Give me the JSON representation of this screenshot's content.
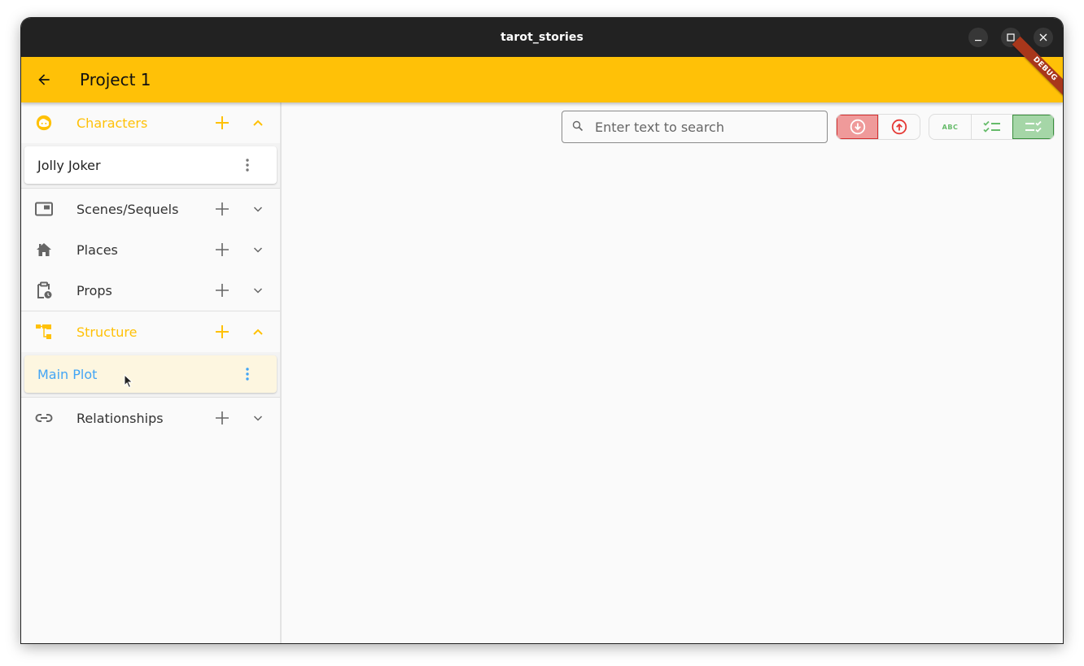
{
  "window": {
    "title": "tarot_stories",
    "controls": [
      "minimize-icon",
      "maximize-icon",
      "close-icon"
    ]
  },
  "appbar": {
    "back_icon": "arrow-back-icon",
    "title": "Project 1",
    "debug_banner": "DEBUG",
    "color": "#ffc107"
  },
  "sidebar": {
    "accent_color": "#ffc107",
    "sections": [
      {
        "label": "Characters",
        "icon": "face-icon",
        "expanded": true,
        "items": [
          {
            "label": "Jolly Joker",
            "selected": false
          }
        ]
      },
      {
        "label": "Scenes/Sequels",
        "icon": "picture-in-picture-icon",
        "expanded": false,
        "items": []
      },
      {
        "label": "Places",
        "icon": "home-icon",
        "expanded": false,
        "items": []
      },
      {
        "label": "Props",
        "icon": "clipboard-clock-icon",
        "expanded": false,
        "items": []
      },
      {
        "label": "Structure",
        "icon": "account-tree-icon",
        "expanded": true,
        "items": [
          {
            "label": "Main Plot",
            "selected": true
          }
        ]
      },
      {
        "label": "Relationships",
        "icon": "link-icon",
        "expanded": false,
        "items": []
      }
    ]
  },
  "toolbar": {
    "search": {
      "placeholder": "Enter text to search",
      "value": "",
      "icon": "search-icon"
    },
    "sort_group": {
      "buttons": [
        {
          "icon": "arrow-circle-down-icon",
          "active": true
        },
        {
          "icon": "arrow-circle-up-icon",
          "active": false
        }
      ],
      "active_color": "#ef9a9a"
    },
    "view_group": {
      "buttons": [
        {
          "icon": "abc-icon",
          "label": "ABC",
          "active": false
        },
        {
          "icon": "checklist-icon",
          "active": false
        },
        {
          "icon": "checklist-rtl-icon",
          "active": true
        }
      ],
      "active_color": "#a5d6a7"
    }
  }
}
